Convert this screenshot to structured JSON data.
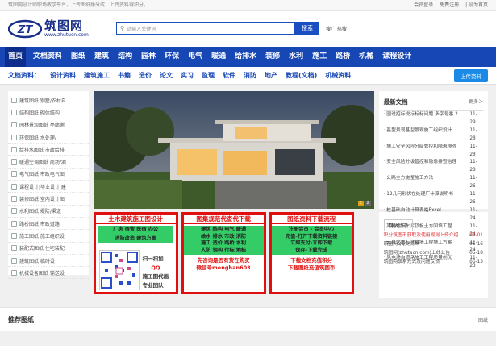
{
  "topbar": {
    "left": "筑图网设计师职场教学平台，上传图纸挣分成，上传资料得积分。",
    "login": "会员登录",
    "register": "免费注册",
    "home": "| 设为首页"
  },
  "logo": {
    "cn": "筑图网",
    "en": "www.zhutucn.com"
  },
  "search": {
    "placeholder": "请输入关键词",
    "button": "搜索",
    "hot_label": "搜广 热搜："
  },
  "nav_main": [
    "首页",
    "文档资料",
    "图纸",
    "建筑",
    "结构",
    "园林",
    "环保",
    "电气",
    "暖通",
    "给排水",
    "装修",
    "水利",
    "施工",
    "路桥",
    "机械",
    "课程设计"
  ],
  "nav_sub": {
    "label": "文档资料：",
    "items": [
      "设计资料",
      "建筑施工",
      "书籍",
      "造价",
      "论文",
      "实习",
      "监理",
      "软件",
      "消防",
      "地产",
      "教程(文档)",
      "机械资料"
    ],
    "upload": "上传资料"
  },
  "sidebar": [
    "建筑图纸 别墅/农村自",
    "结构图纸 砌体结构",
    "园林景观图纸 亭廊榭",
    "环保图纸 水处理/",
    "给排水图纸 市政给排",
    "暖通空调图纸 商场/酒",
    "电气图纸 市政电气图",
    "课程设计|毕业设计 建",
    "装修图纸 室内设计图",
    "水利图纸 堤防/渠道",
    "路桥图纸 市政道路",
    "施工图纸 施工组织设",
    "装配式图纸 住宅装配",
    "建筑图纸 临时设",
    "机械设备图纸 输送设"
  ],
  "banner": {
    "page1": "1",
    "page2": "2"
  },
  "ads": {
    "ad1": {
      "title": "土木建筑施工图设计",
      "g1": "厂房 宿舍 民宿 办公",
      "g2": "消防改造 建筑方案",
      "qq1": "扫一扫加",
      "qq2": "QQ",
      "qq3": "施工图代画",
      "qq4": "专业团队"
    },
    "ad2": {
      "title": "图集规范代查代下载",
      "g": [
        "建筑 结构 电气 暖通",
        "给水 排水 市政 消防",
        "施工 造价 路桥 水利",
        "人防 钢构 行标 地标"
      ],
      "r1": "先咨询是否有货在购买",
      "r2": "微信号menghan603"
    },
    "ad3": {
      "title": "图纸资料下载流程",
      "g": [
        "注册会员 - 会员中心",
        "充值-打开下载资料链接",
        "立即支付-立即下载",
        "保存-下载完成"
      ],
      "r1": "下载文档充值积分",
      "r2": "下载图纸充值筑图币"
    }
  },
  "news": {
    "title": "最新文档",
    "more": "更多＞",
    "items": [
      {
        "t": "园说招标说标标标问题 多字号番 2",
        "d": "11-29"
      },
      {
        "t": "基型景观基型景观施工组织设计",
        "d": "11-28"
      },
      {
        "t": "施工安全风险分级管控和隐患排查",
        "d": "11-28"
      },
      {
        "t": "安全风险分级管控和隐患排查治理",
        "d": "11-28"
      },
      {
        "t": "公路主方施整施工方法",
        "d": "11-26"
      },
      {
        "t": "12几何形伏在处理厂计算说明书",
        "d": "11-26"
      },
      {
        "t": "桩基础自动计算表格Excel",
        "d": "11-24"
      },
      {
        "t": "某地地下车库顶板土方回填工程",
        "d": "11-24"
      },
      {
        "t": "云泉大厦石材幕墙工程施工方案",
        "d": "11-24"
      },
      {
        "t": "风电场自道路施工工程质量创优",
        "d": "11-23"
      }
    ]
  },
  "dyn": {
    "tab": "网站动态",
    "items": [
      {
        "t": "积分筑图币获取及使用规则上传介绍",
        "d": "07-01"
      },
      {
        "t": "筑图网QQ交流群",
        "d": "05-16"
      },
      {
        "t": "筑图网(zhutucn.com)上线公告",
        "d": "05-18"
      },
      {
        "t": "筑图网联系方式及问题反馈",
        "d": "06-13"
      }
    ]
  },
  "bottom": {
    "title": "推荐图纸",
    "more": "图纸"
  },
  "colors": {
    "brand_blue": "#1747b5",
    "ad_red": "#e01010",
    "ad_green": "#33cc66"
  }
}
